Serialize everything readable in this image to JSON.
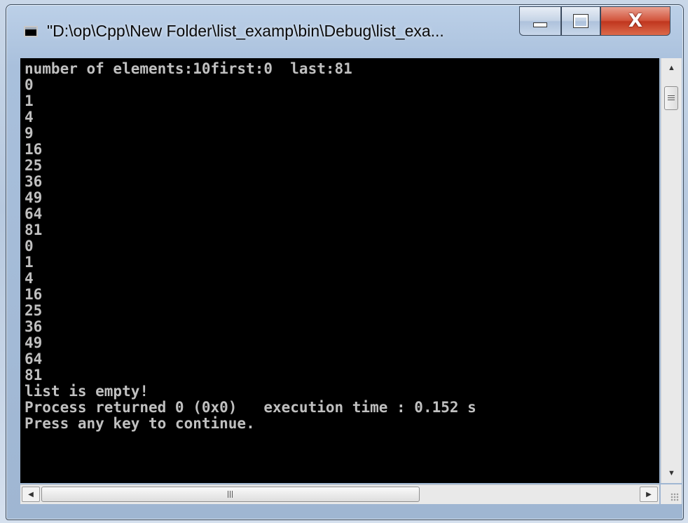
{
  "window": {
    "title": "\"D:\\op\\Cpp\\New Folder\\list_examp\\bin\\Debug\\list_exa...",
    "close_symbol": "X"
  },
  "console": {
    "lines": [
      "number of elements:10first:0  last:81",
      "0",
      "1",
      "4",
      "9",
      "16",
      "25",
      "36",
      "49",
      "64",
      "81",
      "0",
      "1",
      "4",
      "16",
      "25",
      "36",
      "49",
      "64",
      "81",
      "list is empty!",
      "Process returned 0 (0x0)   execution time : 0.152 s",
      "Press any key to continue."
    ]
  },
  "icons": {
    "app": "console-window-icon",
    "minimize": "minimize-icon",
    "maximize": "maximize-icon",
    "close": "close-icon",
    "scroll_up": "arrow-up-icon",
    "scroll_down": "arrow-down-icon",
    "scroll_left": "arrow-left-icon",
    "scroll_right": "arrow-right-icon"
  },
  "colors": {
    "console_bg": "#000000",
    "console_fg": "#c0c0c0",
    "close_button": "#c8452b"
  }
}
